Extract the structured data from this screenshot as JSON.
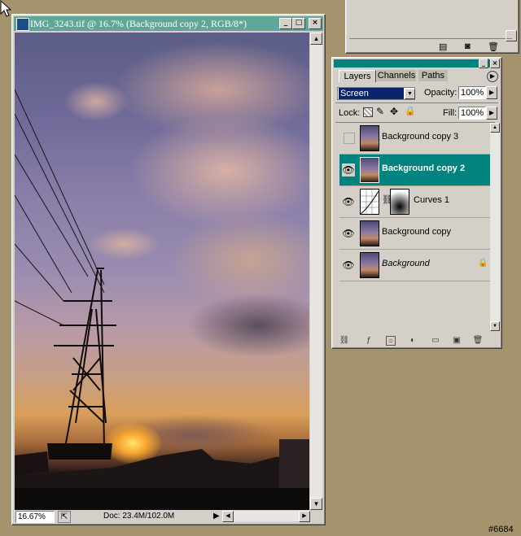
{
  "document": {
    "title": "IMG_3243.tif @ 16.7% (Background copy 2, RGB/8*)",
    "zoom": "16.67%",
    "doc_info": "Doc: 23.4M/102.0M",
    "window_buttons": [
      "_",
      "□",
      "×"
    ]
  },
  "layers_panel": {
    "tabs": [
      "Layers",
      "Channels",
      "Paths"
    ],
    "blend_mode": "Screen",
    "opacity_label": "Opacity:",
    "opacity_value": "100%",
    "lock_label": "Lock:",
    "fill_label": "Fill:",
    "fill_value": "100%",
    "layers": [
      {
        "name": "Background copy 3",
        "visible": false,
        "selected": false
      },
      {
        "name": "Background copy 2",
        "visible": true,
        "selected": true
      },
      {
        "name": "Curves 1",
        "visible": true,
        "selected": false
      },
      {
        "name": "Background copy",
        "visible": true,
        "selected": false
      },
      {
        "name": "Background",
        "visible": true,
        "selected": false
      }
    ]
  },
  "watermark": "#6684",
  "colors": {
    "panel_bg": "#d4d0c8",
    "accent": "#00837f",
    "desktop": "#a5936d"
  }
}
